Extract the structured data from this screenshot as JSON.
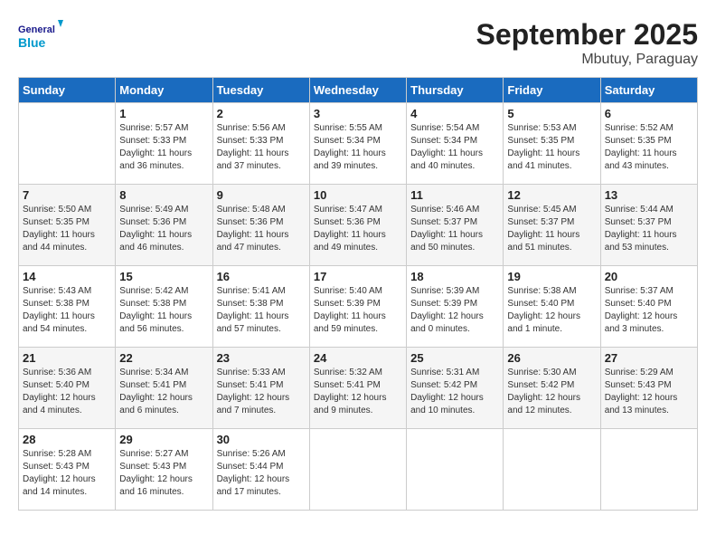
{
  "logo": {
    "general": "General",
    "blue": "Blue"
  },
  "title": "September 2025",
  "location": "Mbutuy, Paraguay",
  "days_of_week": [
    "Sunday",
    "Monday",
    "Tuesday",
    "Wednesday",
    "Thursday",
    "Friday",
    "Saturday"
  ],
  "weeks": [
    [
      {
        "day": "",
        "info": ""
      },
      {
        "day": "1",
        "info": "Sunrise: 5:57 AM\nSunset: 5:33 PM\nDaylight: 11 hours\nand 36 minutes."
      },
      {
        "day": "2",
        "info": "Sunrise: 5:56 AM\nSunset: 5:33 PM\nDaylight: 11 hours\nand 37 minutes."
      },
      {
        "day": "3",
        "info": "Sunrise: 5:55 AM\nSunset: 5:34 PM\nDaylight: 11 hours\nand 39 minutes."
      },
      {
        "day": "4",
        "info": "Sunrise: 5:54 AM\nSunset: 5:34 PM\nDaylight: 11 hours\nand 40 minutes."
      },
      {
        "day": "5",
        "info": "Sunrise: 5:53 AM\nSunset: 5:35 PM\nDaylight: 11 hours\nand 41 minutes."
      },
      {
        "day": "6",
        "info": "Sunrise: 5:52 AM\nSunset: 5:35 PM\nDaylight: 11 hours\nand 43 minutes."
      }
    ],
    [
      {
        "day": "7",
        "info": "Sunrise: 5:50 AM\nSunset: 5:35 PM\nDaylight: 11 hours\nand 44 minutes."
      },
      {
        "day": "8",
        "info": "Sunrise: 5:49 AM\nSunset: 5:36 PM\nDaylight: 11 hours\nand 46 minutes."
      },
      {
        "day": "9",
        "info": "Sunrise: 5:48 AM\nSunset: 5:36 PM\nDaylight: 11 hours\nand 47 minutes."
      },
      {
        "day": "10",
        "info": "Sunrise: 5:47 AM\nSunset: 5:36 PM\nDaylight: 11 hours\nand 49 minutes."
      },
      {
        "day": "11",
        "info": "Sunrise: 5:46 AM\nSunset: 5:37 PM\nDaylight: 11 hours\nand 50 minutes."
      },
      {
        "day": "12",
        "info": "Sunrise: 5:45 AM\nSunset: 5:37 PM\nDaylight: 11 hours\nand 51 minutes."
      },
      {
        "day": "13",
        "info": "Sunrise: 5:44 AM\nSunset: 5:37 PM\nDaylight: 11 hours\nand 53 minutes."
      }
    ],
    [
      {
        "day": "14",
        "info": "Sunrise: 5:43 AM\nSunset: 5:38 PM\nDaylight: 11 hours\nand 54 minutes."
      },
      {
        "day": "15",
        "info": "Sunrise: 5:42 AM\nSunset: 5:38 PM\nDaylight: 11 hours\nand 56 minutes."
      },
      {
        "day": "16",
        "info": "Sunrise: 5:41 AM\nSunset: 5:38 PM\nDaylight: 11 hours\nand 57 minutes."
      },
      {
        "day": "17",
        "info": "Sunrise: 5:40 AM\nSunset: 5:39 PM\nDaylight: 11 hours\nand 59 minutes."
      },
      {
        "day": "18",
        "info": "Sunrise: 5:39 AM\nSunset: 5:39 PM\nDaylight: 12 hours\nand 0 minutes."
      },
      {
        "day": "19",
        "info": "Sunrise: 5:38 AM\nSunset: 5:40 PM\nDaylight: 12 hours\nand 1 minute."
      },
      {
        "day": "20",
        "info": "Sunrise: 5:37 AM\nSunset: 5:40 PM\nDaylight: 12 hours\nand 3 minutes."
      }
    ],
    [
      {
        "day": "21",
        "info": "Sunrise: 5:36 AM\nSunset: 5:40 PM\nDaylight: 12 hours\nand 4 minutes."
      },
      {
        "day": "22",
        "info": "Sunrise: 5:34 AM\nSunset: 5:41 PM\nDaylight: 12 hours\nand 6 minutes."
      },
      {
        "day": "23",
        "info": "Sunrise: 5:33 AM\nSunset: 5:41 PM\nDaylight: 12 hours\nand 7 minutes."
      },
      {
        "day": "24",
        "info": "Sunrise: 5:32 AM\nSunset: 5:41 PM\nDaylight: 12 hours\nand 9 minutes."
      },
      {
        "day": "25",
        "info": "Sunrise: 5:31 AM\nSunset: 5:42 PM\nDaylight: 12 hours\nand 10 minutes."
      },
      {
        "day": "26",
        "info": "Sunrise: 5:30 AM\nSunset: 5:42 PM\nDaylight: 12 hours\nand 12 minutes."
      },
      {
        "day": "27",
        "info": "Sunrise: 5:29 AM\nSunset: 5:43 PM\nDaylight: 12 hours\nand 13 minutes."
      }
    ],
    [
      {
        "day": "28",
        "info": "Sunrise: 5:28 AM\nSunset: 5:43 PM\nDaylight: 12 hours\nand 14 minutes."
      },
      {
        "day": "29",
        "info": "Sunrise: 5:27 AM\nSunset: 5:43 PM\nDaylight: 12 hours\nand 16 minutes."
      },
      {
        "day": "30",
        "info": "Sunrise: 5:26 AM\nSunset: 5:44 PM\nDaylight: 12 hours\nand 17 minutes."
      },
      {
        "day": "",
        "info": ""
      },
      {
        "day": "",
        "info": ""
      },
      {
        "day": "",
        "info": ""
      },
      {
        "day": "",
        "info": ""
      }
    ]
  ]
}
